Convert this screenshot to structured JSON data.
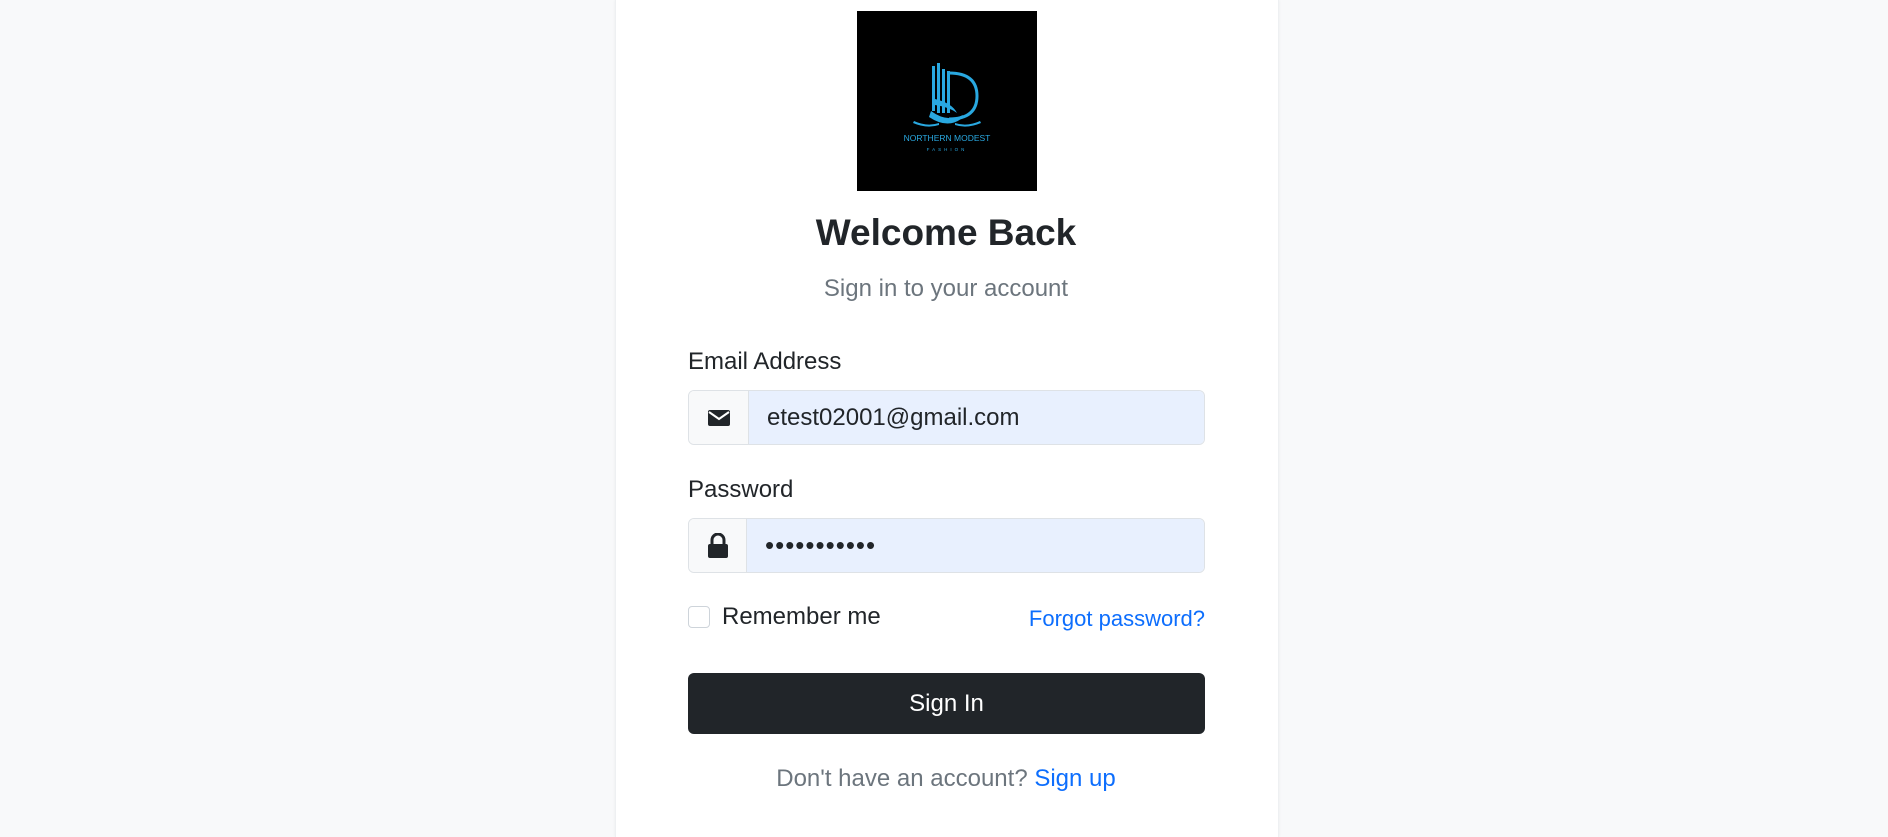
{
  "brand": {
    "logo_icon": "northern-modest-logo",
    "logo_text": "NORTHERN MODEST",
    "logo_subtext": "FASHION",
    "accent_color": "#29a8e0"
  },
  "header": {
    "title": "Welcome Back",
    "subtitle": "Sign in to your account"
  },
  "form": {
    "email": {
      "label": "Email Address",
      "icon": "envelope-icon",
      "value": "etest02001@gmail.com"
    },
    "password": {
      "label": "Password",
      "icon": "lock-icon",
      "value": "•••••••••••"
    },
    "remember_label": "Remember me",
    "remember_checked": false,
    "forgot_label": "Forgot password?",
    "submit_label": "Sign In"
  },
  "footer": {
    "prompt": "Don't have an account?",
    "signup_label": "Sign up"
  },
  "colors": {
    "primary_button": "#212529",
    "link": "#0d6efd",
    "autofill_bg": "#e8f0fe"
  }
}
